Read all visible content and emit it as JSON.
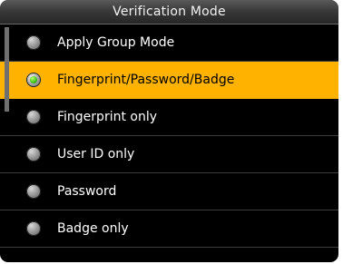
{
  "header": {
    "title": "Verification Mode"
  },
  "colors": {
    "background": "#000000",
    "selected_row": "#ffb300",
    "selected_text": "#000000",
    "text": "#ffffff"
  },
  "options": [
    {
      "label": "Apply Group Mode",
      "selected": false
    },
    {
      "label": "Fingerprint/Password/Badge",
      "selected": true
    },
    {
      "label": "Fingerprint only",
      "selected": false
    },
    {
      "label": "User ID only",
      "selected": false
    },
    {
      "label": "Password",
      "selected": false
    },
    {
      "label": "Badge only",
      "selected": false
    }
  ]
}
